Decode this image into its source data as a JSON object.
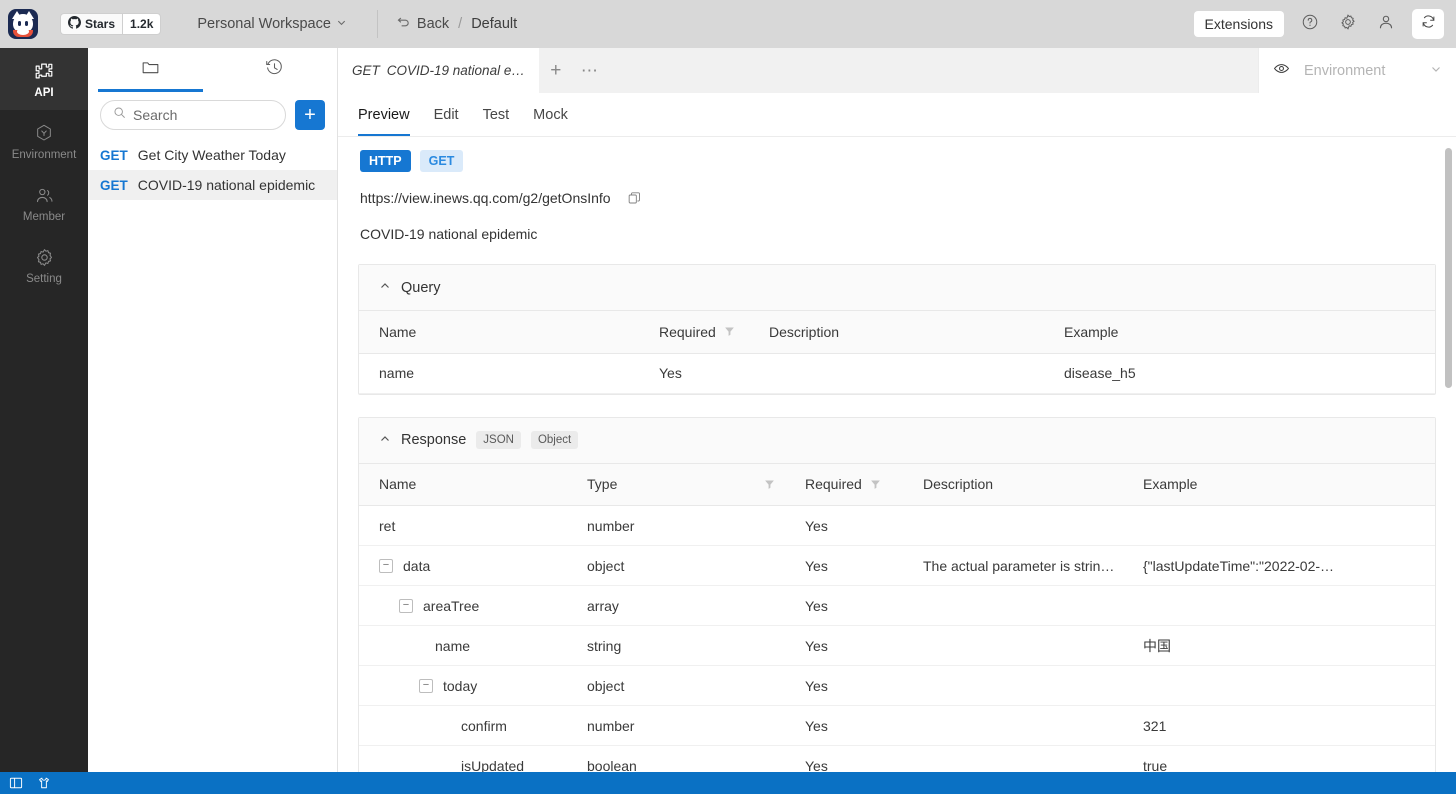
{
  "topbar": {
    "logo_icon": "cat-mascot-logo",
    "stars_label": "Stars",
    "stars_count": "1.2k",
    "github_icon": "github-icon",
    "workspace": "Personal Workspace",
    "chevron_icon": "chevron-down-icon",
    "back_label": "Back",
    "back_icon": "undo-arrow-icon",
    "separator": "/",
    "default_label": "Default",
    "extensions_label": "Extensions",
    "help_icon": "question-circle-icon",
    "settings_icon": "gear-icon",
    "account_icon": "person-icon",
    "refresh_icon": "refresh-sync-icon"
  },
  "rail": {
    "items": [
      {
        "label": "API",
        "icon": "api-plus-icon",
        "active": true
      },
      {
        "label": "Environment",
        "icon": "hexagon-icon",
        "active": false
      },
      {
        "label": "Member",
        "icon": "member-icon",
        "active": false
      },
      {
        "label": "Setting",
        "icon": "gear-icon",
        "active": false
      }
    ]
  },
  "sidebar": {
    "tabs": [
      {
        "name": "collection",
        "icon": "folder-icon",
        "active": true
      },
      {
        "name": "history",
        "icon": "history-clock-icon",
        "active": false
      }
    ],
    "search": {
      "value": "",
      "placeholder": "Search",
      "icon": "search-icon"
    },
    "add_button": "+",
    "apis": [
      {
        "method": "GET",
        "name": "Get City Weather Today",
        "selected": false
      },
      {
        "method": "GET",
        "name": "COVID-19 national epidemic",
        "selected": true
      }
    ]
  },
  "main": {
    "tab": {
      "method": "GET",
      "title": "COVID-19 national e…"
    },
    "tab_add": "+",
    "tab_more": "⋯",
    "environment": {
      "eye_icon": "eye-icon",
      "label": "Environment",
      "chevron_icon": "chevron-down-icon"
    },
    "subtabs": [
      {
        "label": "Preview",
        "active": true
      },
      {
        "label": "Edit",
        "active": false
      },
      {
        "label": "Test",
        "active": false
      },
      {
        "label": "Mock",
        "active": false
      }
    ],
    "badges": {
      "protocol": "HTTP",
      "method": "GET"
    },
    "url": "https://view.inews.qq.com/g2/getOnsInfo",
    "copy_icon": "copy-icon",
    "description": "COVID-19 national epidemic",
    "query_section": {
      "title": "Query",
      "collapse_icon": "chevron-up-icon",
      "columns": [
        "Name",
        "Required",
        "Description",
        "Example"
      ],
      "required_filter_icon": "filter-icon",
      "rows": [
        {
          "name": "name",
          "required": "Yes",
          "description": "",
          "example": "disease_h5"
        }
      ]
    },
    "response_section": {
      "title": "Response",
      "collapse_icon": "chevron-up-icon",
      "chips": [
        "JSON",
        "Object"
      ],
      "columns": [
        "Name",
        "Type",
        "Required",
        "Description",
        "Example"
      ],
      "type_filter_icon": "filter-icon",
      "required_filter_icon": "filter-icon",
      "rows": [
        {
          "name": "ret",
          "indent": 0,
          "expander": "",
          "type": "number",
          "required": "Yes",
          "description": "",
          "example": ""
        },
        {
          "name": "data",
          "indent": 0,
          "expander": "−",
          "type": "object",
          "required": "Yes",
          "description": "The actual parameter is strin…",
          "example": "{\"lastUpdateTime\":\"2022-02-…"
        },
        {
          "name": "areaTree",
          "indent": 1,
          "expander": "−",
          "type": "array",
          "required": "Yes",
          "description": "",
          "example": ""
        },
        {
          "name": "name",
          "indent": 2,
          "expander": "",
          "type": "string",
          "required": "Yes",
          "description": "",
          "example": "中国"
        },
        {
          "name": "today",
          "indent": 2,
          "expander": "−",
          "type": "object",
          "required": "Yes",
          "description": "",
          "example": ""
        },
        {
          "name": "confirm",
          "indent": 3,
          "expander": "",
          "type": "number",
          "required": "Yes",
          "description": "",
          "example": "321"
        },
        {
          "name": "isUpdated",
          "indent": 3,
          "expander": "",
          "type": "boolean",
          "required": "Yes",
          "description": "",
          "example": "true"
        }
      ]
    }
  },
  "statusbar": {
    "panel_icon": "sidebar-toggle-icon",
    "shirt_icon": "theme-shirt-icon"
  },
  "colors": {
    "accent": "#1677d2",
    "status_bar": "#0a71c4",
    "rail_bg": "#262626",
    "topbar_bg": "#d8d8d8"
  }
}
